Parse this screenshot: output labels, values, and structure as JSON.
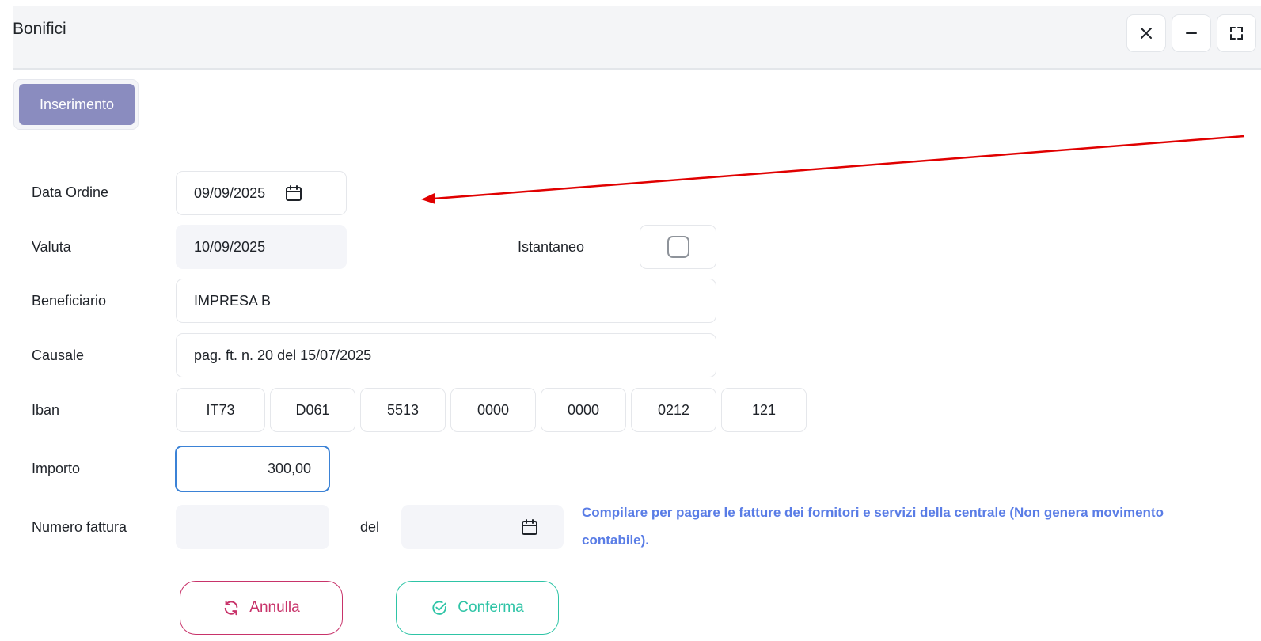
{
  "window": {
    "title": "Bonifici",
    "close_icon": "close-icon",
    "minimize_icon": "minimize-icon",
    "maximize_icon": "maximize-icon"
  },
  "tabs": [
    {
      "label": "Inserimento",
      "active": true
    }
  ],
  "form": {
    "data_ordine": {
      "label": "Data Ordine",
      "value": "09/09/2025"
    },
    "valuta": {
      "label": "Valuta",
      "value": "10/09/2025"
    },
    "istantaneo": {
      "label": "Istantaneo",
      "checked": false
    },
    "beneficiario": {
      "label": "Beneficiario",
      "value": "IMPRESA B"
    },
    "causale": {
      "label": "Causale",
      "value": "pag. ft. n. 20 del 15/07/2025"
    },
    "iban": {
      "label": "Iban",
      "parts": [
        "IT73",
        "D061",
        "5513",
        "0000",
        "0000",
        "0212",
        "121"
      ]
    },
    "importo": {
      "label": "Importo",
      "value": "300,00"
    },
    "numero_fattura": {
      "label": "Numero fattura",
      "value": ""
    },
    "del": {
      "label": "del",
      "value": ""
    },
    "info_text": "Compilare per pagare le fatture dei fornitori e servizi della centrale (Non genera movimento contabile)."
  },
  "buttons": {
    "annulla": "Annulla",
    "conferma": "Conferma"
  },
  "colors": {
    "accent_tab": "#8a8cbf",
    "info_text": "#5a7de6",
    "annulla": "#c8336a",
    "conferma": "#2ec4a6",
    "focus_border": "#3b82d6",
    "annotation_arrow": "#e00000"
  }
}
